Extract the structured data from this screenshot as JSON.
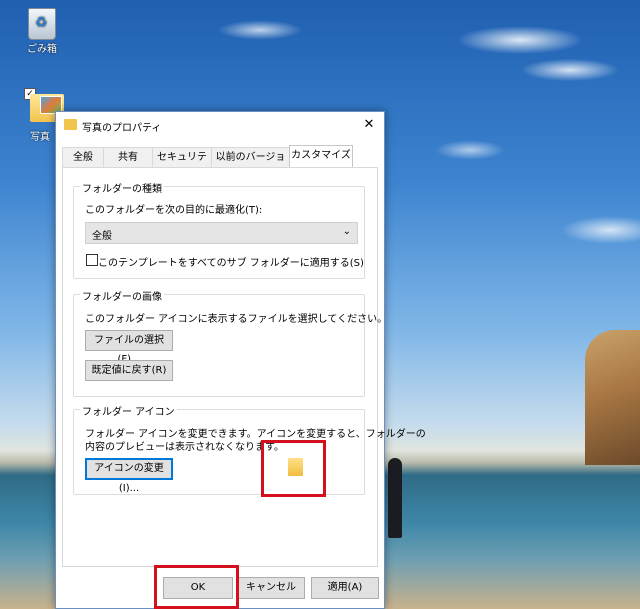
{
  "desktop": {
    "icons": [
      {
        "label": "ごみ箱"
      },
      {
        "label": "写真"
      }
    ]
  },
  "dialog": {
    "title": "写真のプロパティ",
    "close_glyph": "✕",
    "tabs": [
      {
        "label": "全般"
      },
      {
        "label": "共有"
      },
      {
        "label": "セキュリティ"
      },
      {
        "label": "以前のバージョン"
      },
      {
        "label": "カスタマイズ",
        "active": true
      }
    ],
    "folder_type": {
      "legend": "フォルダーの種類",
      "optimize_label": "このフォルダーを次の目的に最適化(T):",
      "selected_option": "全般",
      "apply_subfolders_label": "このテンプレートをすべてのサブ フォルダーに適用する(S)",
      "apply_subfolders_checked": false
    },
    "folder_picture": {
      "legend": "フォルダーの画像",
      "description": "このフォルダー アイコンに表示するファイルを選択してください。",
      "choose_file_button": "ファイルの選択(F)...",
      "restore_default_button": "既定値に戻す(R)"
    },
    "folder_icon": {
      "legend": "フォルダー アイコン",
      "description_line1": "フォルダー アイコンを変更できます。アイコンを変更すると、フォルダーの",
      "description_line2": "内容のプレビューは表示されなくなります。",
      "change_icon_button": "アイコンの変更(I)..."
    },
    "buttons": {
      "ok": "OK",
      "cancel": "キャンセル",
      "apply": "適用(A)"
    }
  },
  "colors": {
    "highlight_box": "#d40f1e",
    "focus_accent": "#0078d7"
  }
}
